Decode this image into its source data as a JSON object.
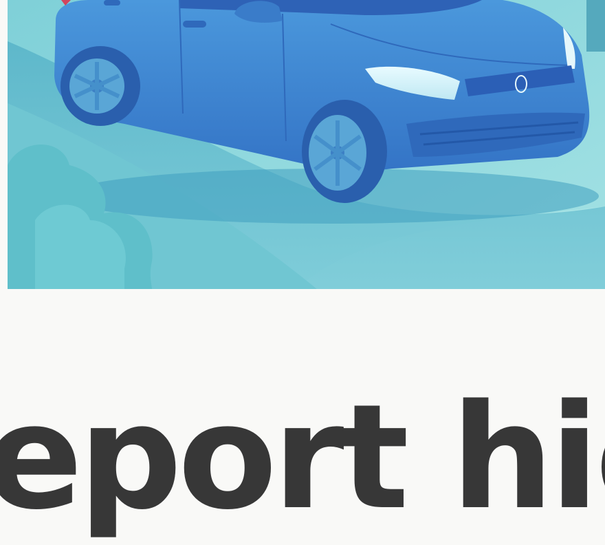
{
  "hero": {
    "icon": "car-illustration",
    "colors": {
      "sky": "#7fd0d8",
      "road": "#62b8cc",
      "car_body": "#3d86d2",
      "car_dark": "#2b5fb6",
      "bush": "#5fbfca"
    }
  },
  "article": {
    "headline": "eport high"
  }
}
